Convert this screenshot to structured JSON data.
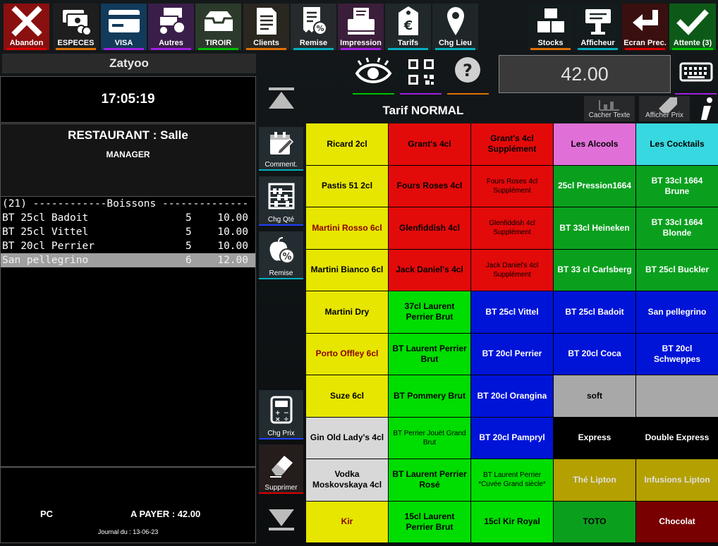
{
  "colors": {
    "red": "#e30a0a",
    "green": "#00dd00",
    "dgreen": "#0aa01e",
    "blue": "#0014d8",
    "yellow": "#e6e600",
    "pink": "#e070d8",
    "cyan": "#38d8e0",
    "gray": "#a8a8a8",
    "white": "#d8d8d8",
    "black": "#000000",
    "olive": "#b4a000",
    "maroon": "#780000"
  },
  "toolbar": {
    "abandon": "Abandon",
    "especes": "ESPECES",
    "visa": "VISA",
    "autres": "Autres",
    "tiroir": "TIROIR",
    "clients": "Clients",
    "remise": "Remise",
    "impression": "Impression",
    "tarifs": "Tarifs",
    "chg_lieu": "Chg Lieu",
    "stocks": "Stocks",
    "afficheur": "Afficheur",
    "ecran_prec": "Ecran Prec.",
    "attente": "Attente (3)"
  },
  "panel": {
    "user": "Zatyoo",
    "time": "17:05:19",
    "location": "RESTAURANT : Salle",
    "role": "MANAGER"
  },
  "ticket": {
    "header": "(21) ------------Boissons --------------",
    "items": [
      {
        "name": "BT 25cl Badoit",
        "qty": "5",
        "price": "10.00"
      },
      {
        "name": "BT 25cl Vittel",
        "qty": "5",
        "price": "10.00"
      },
      {
        "name": "BT 20cl Perrier",
        "qty": "5",
        "price": "10.00"
      },
      {
        "name": "San pellegrino",
        "qty": "6",
        "price": "12.00"
      }
    ]
  },
  "footer": {
    "terminal": "PC",
    "to_pay": "A PAYER :  42.00",
    "journal": "Journal du : 13-06-23"
  },
  "side": {
    "comment": "Comment.",
    "chg_qte": "Chg Qté",
    "remise": "Remise",
    "chg_prix": "Chg Prix",
    "supprimer": "Supprimer"
  },
  "topright": {
    "amount": "42.00",
    "tarif": "Tarif NORMAL",
    "cacher_texte": "Cacher Texte",
    "afficher_prix": "Afficher Prix"
  },
  "products": [
    {
      "label": "Ricard 2cl",
      "bg": "#e6e600",
      "fg": "#000"
    },
    {
      "label": "Grant's 4cl",
      "bg": "#e30a0a",
      "fg": "#000"
    },
    {
      "label": "Grant's 4cl Supplément",
      "bg": "#e30a0a",
      "fg": "#000"
    },
    {
      "label": "Les Alcools",
      "bg": "#e070d8",
      "fg": "#000",
      "small": false
    },
    {
      "label": "Les Cocktails",
      "bg": "#38d8e0",
      "fg": "#000"
    },
    {
      "label": "Pastis 51 2cl",
      "bg": "#e6e600",
      "fg": "#000"
    },
    {
      "label": "Fours Roses 4cl",
      "bg": "#e30a0a",
      "fg": "#000"
    },
    {
      "label": "Fours Roses 4cl Supplément",
      "bg": "#e30a0a",
      "fg": "#000",
      "small": true
    },
    {
      "label": "25cl Pression1664",
      "bg": "#0aa01e",
      "fg": "#fff"
    },
    {
      "label": "BT 33cl 1664 Brune",
      "bg": "#0aa01e",
      "fg": "#fff"
    },
    {
      "label": "Martini Rosso 6cl",
      "bg": "#e6e600",
      "fg": "#8a0000"
    },
    {
      "label": "Glenfiddish 4cl",
      "bg": "#e30a0a",
      "fg": "#000"
    },
    {
      "label": "Glenfiddish 4cl Supplément",
      "bg": "#e30a0a",
      "fg": "#000",
      "small": true
    },
    {
      "label": "BT 33cl Heineken",
      "bg": "#0aa01e",
      "fg": "#fff"
    },
    {
      "label": "BT 33cl 1664 Blonde",
      "bg": "#0aa01e",
      "fg": "#fff"
    },
    {
      "label": "Martini Bianco 6cl",
      "bg": "#e6e600",
      "fg": "#000"
    },
    {
      "label": "Jack Daniel's 4cl",
      "bg": "#e30a0a",
      "fg": "#000"
    },
    {
      "label": "Jack Daniel's 4cl Supplément",
      "bg": "#e30a0a",
      "fg": "#000",
      "small": true
    },
    {
      "label": "BT 33 cl Carlsberg",
      "bg": "#0aa01e",
      "fg": "#fff"
    },
    {
      "label": "BT 25cl Buckler",
      "bg": "#0aa01e",
      "fg": "#fff"
    },
    {
      "label": "Martini Dry",
      "bg": "#e6e600",
      "fg": "#000"
    },
    {
      "label": "37cl Laurent Perrier Brut",
      "bg": "#00dd00",
      "fg": "#000"
    },
    {
      "label": "BT 25cl Vittel",
      "bg": "#0014d8",
      "fg": "#fff"
    },
    {
      "label": "BT 25cl Badoit",
      "bg": "#0014d8",
      "fg": "#fff"
    },
    {
      "label": "San pellegrino",
      "bg": "#0014d8",
      "fg": "#fff"
    },
    {
      "label": "Porto Offley 6cl",
      "bg": "#e6e600",
      "fg": "#8a0000"
    },
    {
      "label": "BT Laurent Perrier Brut",
      "bg": "#00dd00",
      "fg": "#000"
    },
    {
      "label": "BT 20cl Perrier",
      "bg": "#0014d8",
      "fg": "#fff"
    },
    {
      "label": "BT 20cl Coca",
      "bg": "#0014d8",
      "fg": "#fff"
    },
    {
      "label": "BT 20cl Schweppes",
      "bg": "#0014d8",
      "fg": "#fff"
    },
    {
      "label": "Suze 6cl",
      "bg": "#e6e600",
      "fg": "#000"
    },
    {
      "label": "BT Pommery Brut",
      "bg": "#00dd00",
      "fg": "#000"
    },
    {
      "label": "BT 20cl Orangina",
      "bg": "#0014d8",
      "fg": "#fff"
    },
    {
      "label": "soft",
      "bg": "#a8a8a8",
      "fg": "#000"
    },
    {
      "label": "",
      "bg": "#a8a8a8",
      "fg": "#000"
    },
    {
      "label": "Gin Old Lady's 4cl",
      "bg": "#d8d8d8",
      "fg": "#000"
    },
    {
      "label": "BT Perrier Jouët Grand Brut",
      "bg": "#00dd00",
      "fg": "#000",
      "small": true
    },
    {
      "label": "BT 20cl Pampryl",
      "bg": "#0014d8",
      "fg": "#fff"
    },
    {
      "label": "Express",
      "bg": "#000000",
      "fg": "#fff"
    },
    {
      "label": "Double Express",
      "bg": "#000000",
      "fg": "#fff"
    },
    {
      "label": "Vodka Moskovskaya 4cl",
      "bg": "#d8d8d8",
      "fg": "#000"
    },
    {
      "label": "BT Laurent Perrier Rosé",
      "bg": "#00dd00",
      "fg": "#000"
    },
    {
      "label": "BT Laurent Perrier *Cuvée Grand siècle*",
      "bg": "#00dd00",
      "fg": "#000",
      "small": true
    },
    {
      "label": "Thé Lipton",
      "bg": "#b4a000",
      "fg": "#e0e0e0"
    },
    {
      "label": "Infusions Lipton",
      "bg": "#b4a000",
      "fg": "#e0e0e0"
    },
    {
      "label": "Kir",
      "bg": "#e6e600",
      "fg": "#8a0000"
    },
    {
      "label": "15cl Laurent Perrier Brut",
      "bg": "#00dd00",
      "fg": "#000"
    },
    {
      "label": "15cl Kir Royal",
      "bg": "#00dd00",
      "fg": "#000"
    },
    {
      "label": "TOTO",
      "bg": "#0aa01e",
      "fg": "#000"
    },
    {
      "label": "Chocolat",
      "bg": "#780000",
      "fg": "#fff"
    }
  ]
}
